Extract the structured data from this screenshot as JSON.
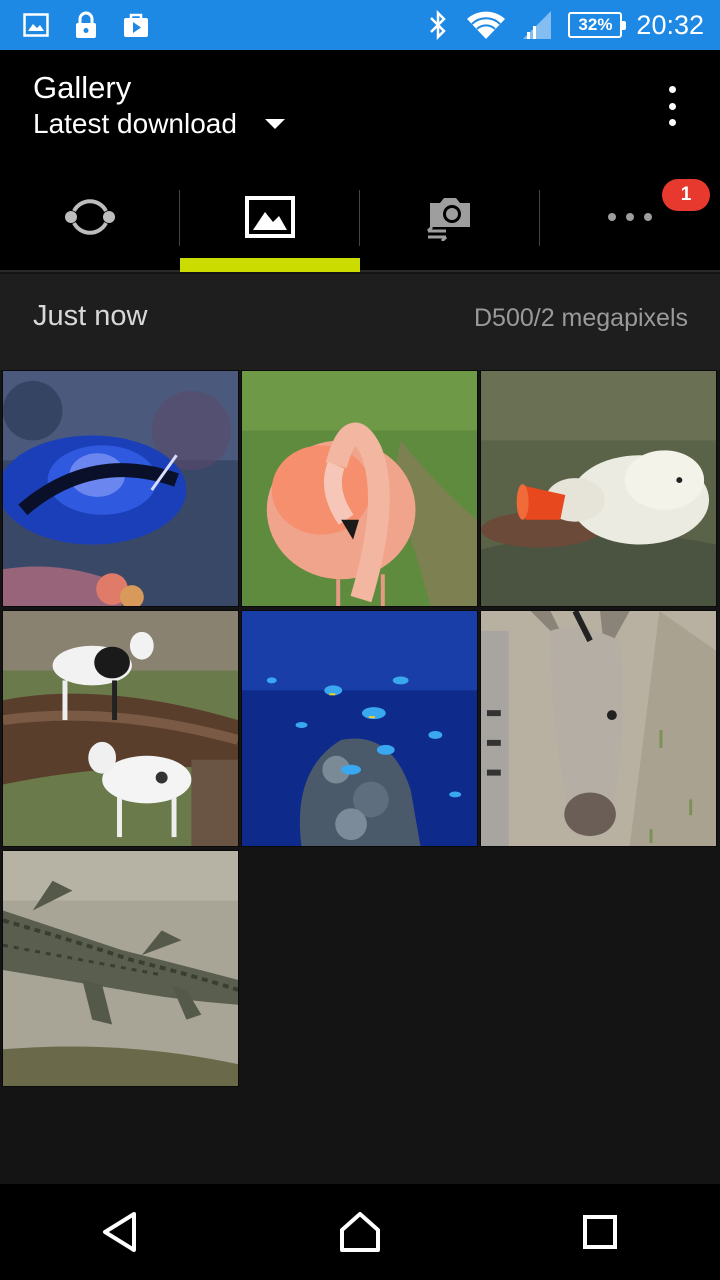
{
  "status_bar": {
    "icons_left": [
      "image-notification-icon",
      "lock-notification-icon",
      "play-store-notification-icon"
    ],
    "icons_right": [
      "bluetooth-icon",
      "wifi-icon",
      "signal-icon"
    ],
    "battery": "32%",
    "time": "20:32",
    "bg_color": "#1e88e5"
  },
  "app_bar": {
    "title": "Gallery",
    "subtitle": "Latest download"
  },
  "tabs": [
    {
      "icon": "sync-icon",
      "selected": false
    },
    {
      "icon": "photo-icon",
      "selected": true
    },
    {
      "icon": "camera-transfer-icon",
      "selected": false
    },
    {
      "icon": "more-dots-icon",
      "selected": false,
      "badge": "1"
    }
  ],
  "accent_color": "#cbdc00",
  "section": {
    "title": "Just now",
    "meta": "D500/2 megapixels"
  },
  "photos": [
    {
      "name": "photo-blue-tang-fish"
    },
    {
      "name": "photo-flamingo"
    },
    {
      "name": "photo-polar-bear"
    },
    {
      "name": "photo-goats"
    },
    {
      "name": "photo-aquarium-fish"
    },
    {
      "name": "photo-donkey"
    },
    {
      "name": "photo-crocodile"
    }
  ],
  "nav": [
    "back-icon",
    "home-icon",
    "recents-icon"
  ]
}
